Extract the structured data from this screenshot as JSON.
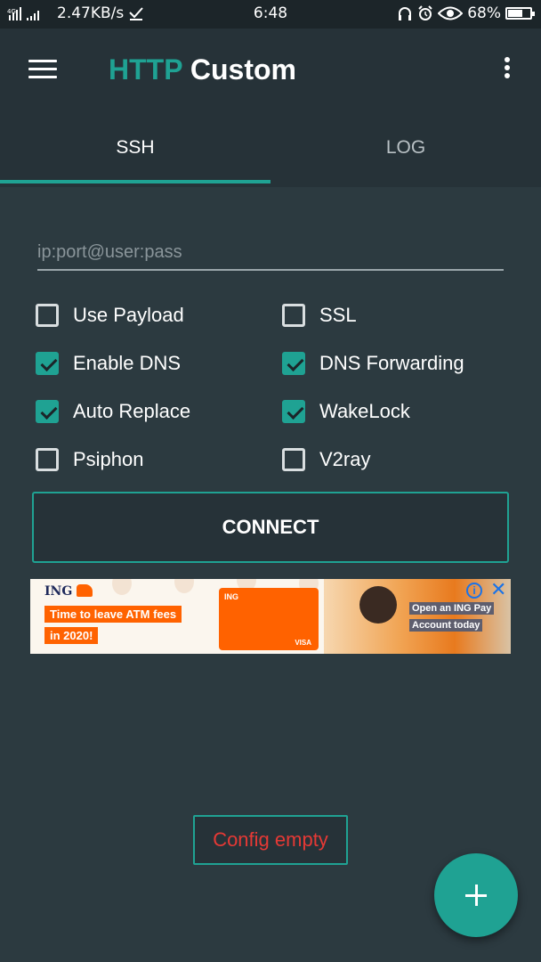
{
  "status_bar": {
    "network_speed": "2.47KB/s",
    "time": "6:48",
    "battery_percent": "68%",
    "battery_level": 0.68,
    "icons": [
      "signal-icon",
      "download-check-icon",
      "headset-icon",
      "alarm-icon",
      "eye-icon",
      "battery-icon"
    ]
  },
  "app_bar": {
    "title_accent": "HTTP",
    "title_rest": "Custom",
    "accent_color": "#1fa293"
  },
  "tabs": [
    {
      "label": "SSH",
      "active": true
    },
    {
      "label": "LOG",
      "active": false
    }
  ],
  "server_input": {
    "value": "",
    "placeholder": "ip:port@user:pass"
  },
  "options": [
    {
      "label": "Use Payload",
      "checked": false
    },
    {
      "label": "SSL",
      "checked": false
    },
    {
      "label": "Enable DNS",
      "checked": true
    },
    {
      "label": "DNS Forwarding",
      "checked": true
    },
    {
      "label": "Auto Replace",
      "checked": true
    },
    {
      "label": "WakeLock",
      "checked": true
    },
    {
      "label": "Psiphon",
      "checked": false
    },
    {
      "label": "V2ray",
      "checked": false
    }
  ],
  "connect_label": "CONNECT",
  "ad": {
    "brand": "ING",
    "line1": "Time to leave ATM fees",
    "line2": "in 2020!",
    "card_brand": "ING",
    "card_network": "VISA",
    "cta1": "Open an ING Pay",
    "cta2": "Account today"
  },
  "config_status": "Config empty",
  "config_status_color": "#e53935"
}
